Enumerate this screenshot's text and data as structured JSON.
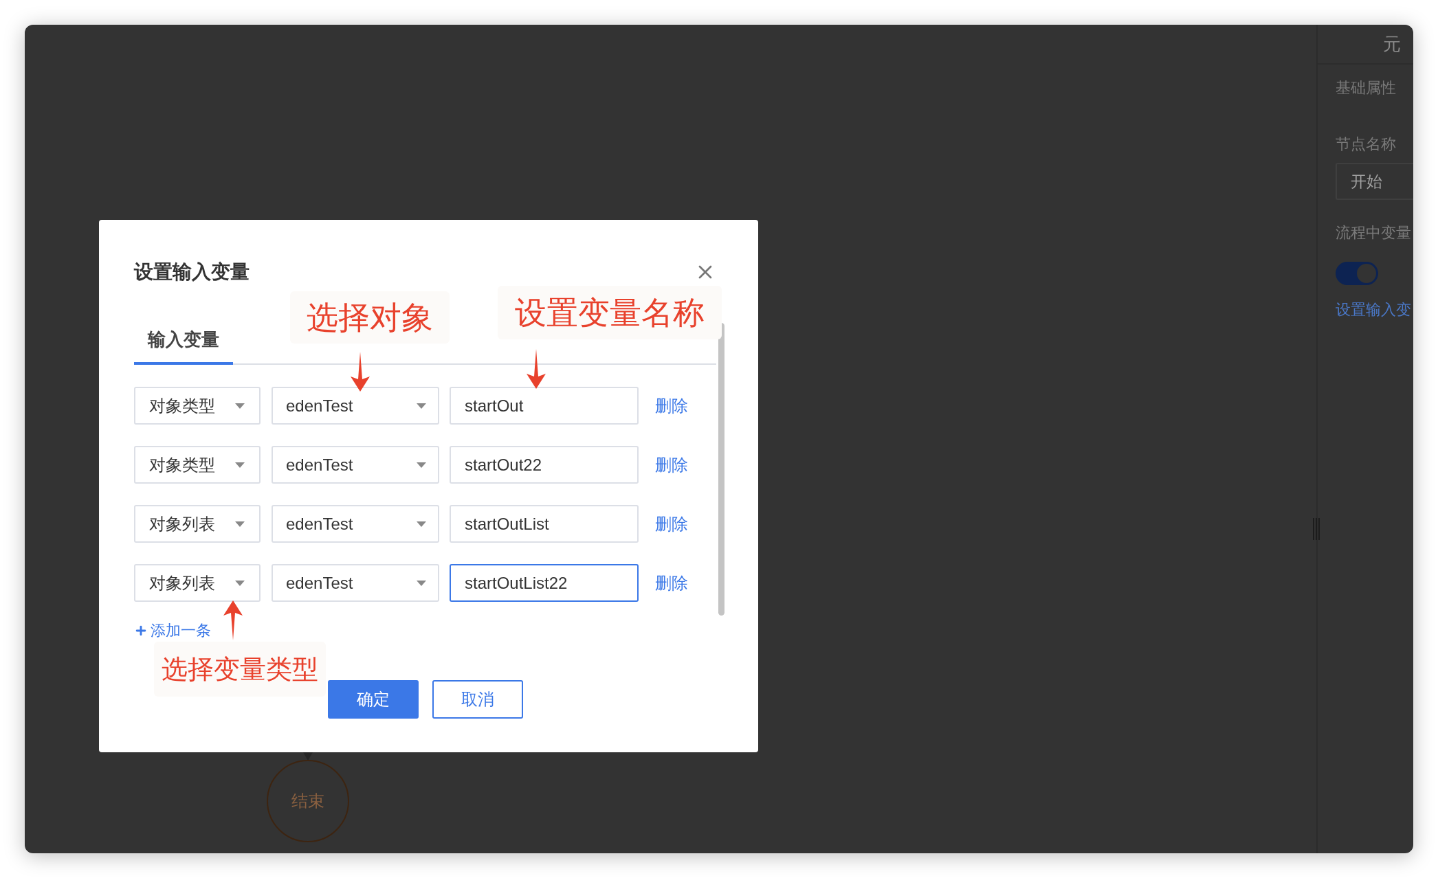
{
  "canvas": {
    "end_node": "结束"
  },
  "panel": {
    "header": "元",
    "section": "基础属性",
    "node_name_label": "节点名称",
    "node_name_value": "开始",
    "variables_label": "流程中变量",
    "variables_switch": {
      "on": true
    },
    "set_input_link": "设置输入变"
  },
  "dialog": {
    "title": "设置输入变量",
    "tabs": [
      {
        "label": "输入变量",
        "selected": true
      }
    ],
    "rows": [
      {
        "type": "对象类型",
        "object": "edenTest",
        "name": "startOut",
        "focused": false,
        "action": "删除"
      },
      {
        "type": "对象类型",
        "object": "edenTest",
        "name": "startOut22",
        "focused": false,
        "action": "删除"
      },
      {
        "type": "对象列表",
        "object": "edenTest",
        "name": "startOutList",
        "focused": false,
        "action": "删除"
      },
      {
        "type": "对象列表",
        "object": "edenTest",
        "name": "startOutList22",
        "focused": true,
        "action": "删除"
      }
    ],
    "add_link": "添加一条",
    "buttons": [
      {
        "label": "确定",
        "kind": "primary"
      },
      {
        "label": "取消",
        "kind": "secondary"
      }
    ]
  },
  "annotations": [
    {
      "text": "选择对象",
      "kind": "down"
    },
    {
      "text": "设置变量名称",
      "kind": "down"
    },
    {
      "text": "选择变量类型",
      "kind": "up"
    }
  ]
}
